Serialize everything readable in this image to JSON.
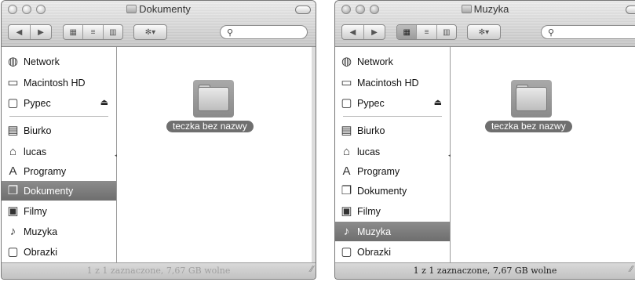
{
  "windows": [
    {
      "title": "Dokumenty",
      "title_icon": "folder-icon",
      "toolbar": {
        "back_icon": "back-arrow-icon",
        "forward_icon": "forward-arrow-icon",
        "view_buttons": [
          "icon-view",
          "list-view",
          "column-view"
        ],
        "action_icon": "gear-icon",
        "search_icon": "search-icon"
      },
      "sidebar": {
        "devices": [
          {
            "label": "Network",
            "icon": "network-globe-icon"
          },
          {
            "label": "Macintosh HD",
            "icon": "hard-drive-icon"
          },
          {
            "label": "Pypec",
            "icon": "disk-icon",
            "eject": "⏏"
          }
        ],
        "places": [
          {
            "label": "Biurko",
            "icon": "desktop-icon"
          },
          {
            "label": "lucas",
            "icon": "home-icon"
          },
          {
            "label": "Programy",
            "icon": "applications-icon"
          },
          {
            "label": "Dokumenty",
            "icon": "documents-icon",
            "selected": true
          },
          {
            "label": "Filmy",
            "icon": "movies-icon"
          },
          {
            "label": "Muzyka",
            "icon": "music-icon"
          },
          {
            "label": "Obrazki",
            "icon": "pictures-icon"
          }
        ]
      },
      "content": {
        "items": [
          {
            "label": "teczka bez nazwy",
            "icon": "folder-icon",
            "selected": true
          }
        ]
      },
      "status": "1 z 1 zaznaczone, 7,67 GB wolne"
    },
    {
      "title": "Muzyka",
      "title_icon": "music-icon",
      "toolbar": {
        "back_icon": "back-arrow-icon",
        "forward_icon": "forward-arrow-icon",
        "view_buttons": [
          "icon-view",
          "list-view",
          "column-view"
        ],
        "action_icon": "gear-icon",
        "search_icon": "search-icon"
      },
      "sidebar": {
        "devices": [
          {
            "label": "Network",
            "icon": "network-globe-icon"
          },
          {
            "label": "Macintosh HD",
            "icon": "hard-drive-icon"
          },
          {
            "label": "Pypec",
            "icon": "disk-icon",
            "eject": "⏏"
          }
        ],
        "places": [
          {
            "label": "Biurko",
            "icon": "desktop-icon"
          },
          {
            "label": "lucas",
            "icon": "home-icon"
          },
          {
            "label": "Programy",
            "icon": "applications-icon"
          },
          {
            "label": "Dokumenty",
            "icon": "documents-icon"
          },
          {
            "label": "Filmy",
            "icon": "movies-icon"
          },
          {
            "label": "Muzyka",
            "icon": "music-icon",
            "selected": true
          },
          {
            "label": "Obrazki",
            "icon": "pictures-icon"
          }
        ]
      },
      "content": {
        "items": [
          {
            "label": "teczka bez nazwy",
            "icon": "folder-icon",
            "selected": true
          }
        ]
      },
      "status": "1 z 1 zaznaczone, 7,67 GB wolne"
    }
  ]
}
